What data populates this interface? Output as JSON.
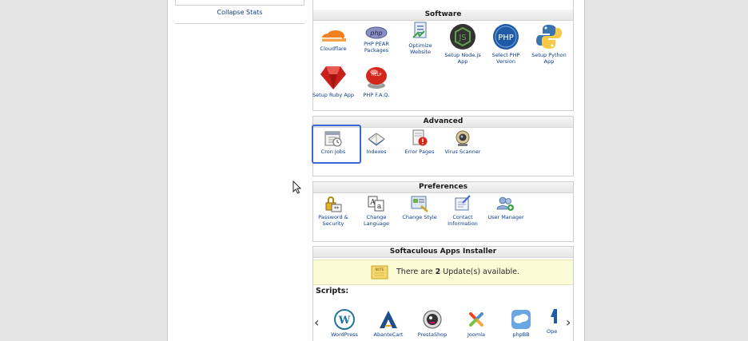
{
  "sidebar": {
    "collapse_label": "Collapse Stats"
  },
  "software": {
    "title": "Software",
    "items": [
      {
        "label": "Cloudflare",
        "icon": "cloudflare-icon"
      },
      {
        "label": "PHP PEAR Packages",
        "icon": "php-pear-icon"
      },
      {
        "label": "Optimize Website",
        "icon": "optimize-icon"
      },
      {
        "label": "Setup Node.js App",
        "icon": "nodejs-icon"
      },
      {
        "label": "Select PHP Version",
        "icon": "php-icon"
      },
      {
        "label": "Setup Python App",
        "icon": "python-icon"
      },
      {
        "label": "Setup Ruby App",
        "icon": "ruby-icon"
      },
      {
        "label": "PHP F.A.Q.",
        "icon": "help-button-icon"
      }
    ]
  },
  "advanced": {
    "title": "Advanced",
    "items": [
      {
        "label": "Cron Jobs",
        "icon": "calendar-clock-icon"
      },
      {
        "label": "Indexes",
        "icon": "book-icon"
      },
      {
        "label": "Error Pages",
        "icon": "error-page-icon"
      },
      {
        "label": "Virus Scanner",
        "icon": "scanner-icon"
      }
    ]
  },
  "preferences": {
    "title": "Preferences",
    "items": [
      {
        "label": "Password & Security",
        "icon": "lock-icon"
      },
      {
        "label": "Change Language",
        "icon": "language-icon"
      },
      {
        "label": "Change Style",
        "icon": "style-icon"
      },
      {
        "label": "Contact Information",
        "icon": "contact-icon"
      },
      {
        "label": "User Manager",
        "icon": "users-icon"
      }
    ]
  },
  "softaculous": {
    "title": "Softaculous Apps Installer",
    "notice_prefix": "There are ",
    "notice_count": "2",
    "notice_suffix": " Update(s) available.",
    "note_label": "NOTE",
    "scripts_label": "Scripts:",
    "scripts": [
      "WordPress",
      "AbanteCart",
      "PrestaShop",
      "Joomla",
      "phpBB",
      "Ope"
    ]
  },
  "colors": {
    "link": "#0a3c8c",
    "highlight": "#3b67d9",
    "notice_bg": "#fbfbd6"
  }
}
